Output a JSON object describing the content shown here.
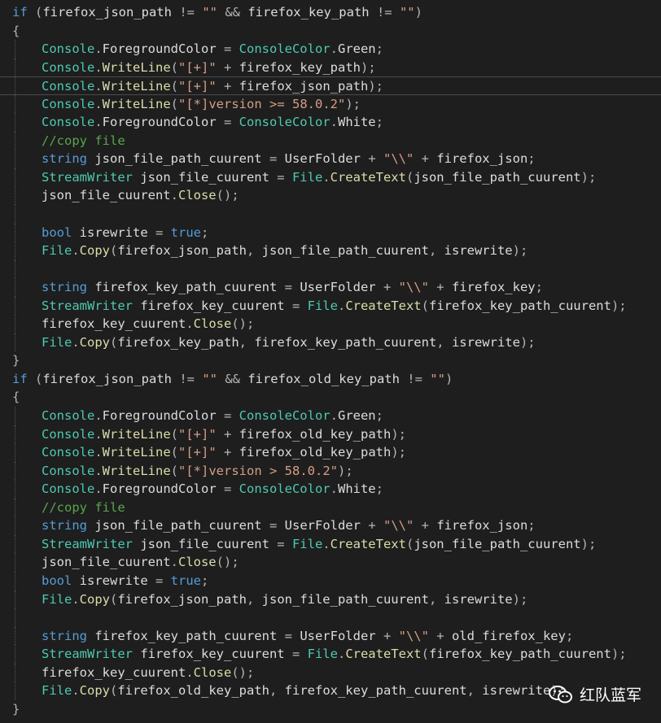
{
  "editor": {
    "lines": [
      {
        "indent": 0,
        "tokens": [
          [
            "kw",
            "if"
          ],
          [
            "pl",
            " ("
          ],
          [
            "id",
            "firefox_json_path"
          ],
          [
            "pl",
            " != "
          ],
          [
            "str",
            "\"\""
          ],
          [
            "pl",
            " && "
          ],
          [
            "id",
            "firefox_key_path"
          ],
          [
            "pl",
            " != "
          ],
          [
            "str",
            "\"\""
          ],
          [
            "pl",
            ")"
          ]
        ]
      },
      {
        "indent": 0,
        "tokens": [
          [
            "pl",
            "{"
          ]
        ]
      },
      {
        "indent": 1,
        "tokens": [
          [
            "type",
            "Console"
          ],
          [
            "pl",
            "."
          ],
          [
            "id",
            "ForegroundColor"
          ],
          [
            "pl",
            " = "
          ],
          [
            "type",
            "ConsoleColor"
          ],
          [
            "pl",
            "."
          ],
          [
            "id",
            "Green"
          ],
          [
            "pl",
            ";"
          ]
        ]
      },
      {
        "indent": 1,
        "tokens": [
          [
            "type",
            "Console"
          ],
          [
            "pl",
            "."
          ],
          [
            "fn",
            "WriteLine"
          ],
          [
            "pl",
            "("
          ],
          [
            "str",
            "\"[+]\""
          ],
          [
            "pl",
            " + "
          ],
          [
            "id",
            "firefox_key_path"
          ],
          [
            "pl",
            ");"
          ]
        ]
      },
      {
        "indent": 1,
        "current": true,
        "tokens": [
          [
            "type",
            "Console"
          ],
          [
            "pl",
            "."
          ],
          [
            "fn",
            "WriteLine"
          ],
          [
            "pl",
            "("
          ],
          [
            "str",
            "\"[+]\""
          ],
          [
            "pl",
            " + "
          ],
          [
            "id",
            "firefox_json_path"
          ],
          [
            "pl",
            ");"
          ]
        ]
      },
      {
        "indent": 1,
        "tokens": [
          [
            "type",
            "Console"
          ],
          [
            "pl",
            "."
          ],
          [
            "fn",
            "WriteLine"
          ],
          [
            "pl",
            "("
          ],
          [
            "str",
            "\"[*]version >= 58.0.2\""
          ],
          [
            "pl",
            ");"
          ]
        ]
      },
      {
        "indent": 1,
        "tokens": [
          [
            "type",
            "Console"
          ],
          [
            "pl",
            "."
          ],
          [
            "id",
            "ForegroundColor"
          ],
          [
            "pl",
            " = "
          ],
          [
            "type",
            "ConsoleColor"
          ],
          [
            "pl",
            "."
          ],
          [
            "id",
            "White"
          ],
          [
            "pl",
            ";"
          ]
        ]
      },
      {
        "indent": 1,
        "tokens": [
          [
            "com",
            "//copy file"
          ]
        ]
      },
      {
        "indent": 1,
        "tokens": [
          [
            "kw",
            "string"
          ],
          [
            "pl",
            " "
          ],
          [
            "id",
            "json_file_path_cuurent"
          ],
          [
            "pl",
            " = "
          ],
          [
            "id",
            "UserFolder"
          ],
          [
            "pl",
            " + "
          ],
          [
            "str",
            "\"\\\\\""
          ],
          [
            "pl",
            " + "
          ],
          [
            "id",
            "firefox_json"
          ],
          [
            "pl",
            ";"
          ]
        ]
      },
      {
        "indent": 1,
        "tokens": [
          [
            "type",
            "StreamWriter"
          ],
          [
            "pl",
            " "
          ],
          [
            "id",
            "json_file_cuurent"
          ],
          [
            "pl",
            " = "
          ],
          [
            "type",
            "File"
          ],
          [
            "pl",
            "."
          ],
          [
            "fn",
            "CreateText"
          ],
          [
            "pl",
            "("
          ],
          [
            "id",
            "json_file_path_cuurent"
          ],
          [
            "pl",
            ");"
          ]
        ]
      },
      {
        "indent": 1,
        "tokens": [
          [
            "id",
            "json_file_cuurent"
          ],
          [
            "pl",
            "."
          ],
          [
            "fn",
            "Close"
          ],
          [
            "pl",
            "();"
          ]
        ]
      },
      {
        "indent": 1,
        "tokens": []
      },
      {
        "indent": 1,
        "tokens": [
          [
            "kw",
            "bool"
          ],
          [
            "pl",
            " "
          ],
          [
            "id",
            "isrewrite"
          ],
          [
            "pl",
            " = "
          ],
          [
            "kw",
            "true"
          ],
          [
            "pl",
            ";"
          ]
        ]
      },
      {
        "indent": 1,
        "tokens": [
          [
            "type",
            "File"
          ],
          [
            "pl",
            "."
          ],
          [
            "fn",
            "Copy"
          ],
          [
            "pl",
            "("
          ],
          [
            "id",
            "firefox_json_path"
          ],
          [
            "pl",
            ", "
          ],
          [
            "id",
            "json_file_path_cuurent"
          ],
          [
            "pl",
            ", "
          ],
          [
            "id",
            "isrewrite"
          ],
          [
            "pl",
            ");"
          ]
        ]
      },
      {
        "indent": 1,
        "tokens": []
      },
      {
        "indent": 1,
        "tokens": [
          [
            "kw",
            "string"
          ],
          [
            "pl",
            " "
          ],
          [
            "id",
            "firefox_key_path_cuurent"
          ],
          [
            "pl",
            " = "
          ],
          [
            "id",
            "UserFolder"
          ],
          [
            "pl",
            " + "
          ],
          [
            "str",
            "\"\\\\\""
          ],
          [
            "pl",
            " + "
          ],
          [
            "id",
            "firefox_key"
          ],
          [
            "pl",
            ";"
          ]
        ]
      },
      {
        "indent": 1,
        "tokens": [
          [
            "type",
            "StreamWriter"
          ],
          [
            "pl",
            " "
          ],
          [
            "id",
            "firefox_key_cuurent"
          ],
          [
            "pl",
            " = "
          ],
          [
            "type",
            "File"
          ],
          [
            "pl",
            "."
          ],
          [
            "fn",
            "CreateText"
          ],
          [
            "pl",
            "("
          ],
          [
            "id",
            "firefox_key_path_cuurent"
          ],
          [
            "pl",
            ");"
          ]
        ]
      },
      {
        "indent": 1,
        "tokens": [
          [
            "id",
            "firefox_key_cuurent"
          ],
          [
            "pl",
            "."
          ],
          [
            "fn",
            "Close"
          ],
          [
            "pl",
            "();"
          ]
        ]
      },
      {
        "indent": 1,
        "tokens": [
          [
            "type",
            "File"
          ],
          [
            "pl",
            "."
          ],
          [
            "fn",
            "Copy"
          ],
          [
            "pl",
            "("
          ],
          [
            "id",
            "firefox_key_path"
          ],
          [
            "pl",
            ", "
          ],
          [
            "id",
            "firefox_key_path_cuurent"
          ],
          [
            "pl",
            ", "
          ],
          [
            "id",
            "isrewrite"
          ],
          [
            "pl",
            ");"
          ]
        ]
      },
      {
        "indent": 0,
        "tokens": [
          [
            "pl",
            "}"
          ]
        ]
      },
      {
        "indent": 0,
        "tokens": [
          [
            "kw",
            "if"
          ],
          [
            "pl",
            " ("
          ],
          [
            "id",
            "firefox_json_path"
          ],
          [
            "pl",
            " != "
          ],
          [
            "str",
            "\"\""
          ],
          [
            "pl",
            " && "
          ],
          [
            "id",
            "firefox_old_key_path"
          ],
          [
            "pl",
            " != "
          ],
          [
            "str",
            "\"\""
          ],
          [
            "pl",
            ")"
          ]
        ]
      },
      {
        "indent": 0,
        "tokens": [
          [
            "pl",
            "{"
          ]
        ]
      },
      {
        "indent": 1,
        "tokens": [
          [
            "type",
            "Console"
          ],
          [
            "pl",
            "."
          ],
          [
            "id",
            "ForegroundColor"
          ],
          [
            "pl",
            " = "
          ],
          [
            "type",
            "ConsoleColor"
          ],
          [
            "pl",
            "."
          ],
          [
            "id",
            "Green"
          ],
          [
            "pl",
            ";"
          ]
        ]
      },
      {
        "indent": 1,
        "tokens": [
          [
            "type",
            "Console"
          ],
          [
            "pl",
            "."
          ],
          [
            "fn",
            "WriteLine"
          ],
          [
            "pl",
            "("
          ],
          [
            "str",
            "\"[+]\""
          ],
          [
            "pl",
            " + "
          ],
          [
            "id",
            "firefox_old_key_path"
          ],
          [
            "pl",
            ");"
          ]
        ]
      },
      {
        "indent": 1,
        "tokens": [
          [
            "type",
            "Console"
          ],
          [
            "pl",
            "."
          ],
          [
            "fn",
            "WriteLine"
          ],
          [
            "pl",
            "("
          ],
          [
            "str",
            "\"[+]\""
          ],
          [
            "pl",
            " + "
          ],
          [
            "id",
            "firefox_old_key_path"
          ],
          [
            "pl",
            ");"
          ]
        ]
      },
      {
        "indent": 1,
        "tokens": [
          [
            "type",
            "Console"
          ],
          [
            "pl",
            "."
          ],
          [
            "fn",
            "WriteLine"
          ],
          [
            "pl",
            "("
          ],
          [
            "str",
            "\"[*]version > 58.0.2\""
          ],
          [
            "pl",
            ");"
          ]
        ]
      },
      {
        "indent": 1,
        "tokens": [
          [
            "type",
            "Console"
          ],
          [
            "pl",
            "."
          ],
          [
            "id",
            "ForegroundColor"
          ],
          [
            "pl",
            " = "
          ],
          [
            "type",
            "ConsoleColor"
          ],
          [
            "pl",
            "."
          ],
          [
            "id",
            "White"
          ],
          [
            "pl",
            ";"
          ]
        ]
      },
      {
        "indent": 1,
        "tokens": [
          [
            "com",
            "//copy file"
          ]
        ]
      },
      {
        "indent": 1,
        "tokens": [
          [
            "kw",
            "string"
          ],
          [
            "pl",
            " "
          ],
          [
            "id",
            "json_file_path_cuurent"
          ],
          [
            "pl",
            " = "
          ],
          [
            "id",
            "UserFolder"
          ],
          [
            "pl",
            " + "
          ],
          [
            "str",
            "\"\\\\\""
          ],
          [
            "pl",
            " + "
          ],
          [
            "id",
            "firefox_json"
          ],
          [
            "pl",
            ";"
          ]
        ]
      },
      {
        "indent": 1,
        "tokens": [
          [
            "type",
            "StreamWriter"
          ],
          [
            "pl",
            " "
          ],
          [
            "id",
            "json_file_cuurent"
          ],
          [
            "pl",
            " = "
          ],
          [
            "type",
            "File"
          ],
          [
            "pl",
            "."
          ],
          [
            "fn",
            "CreateText"
          ],
          [
            "pl",
            "("
          ],
          [
            "id",
            "json_file_path_cuurent"
          ],
          [
            "pl",
            ");"
          ]
        ]
      },
      {
        "indent": 1,
        "tokens": [
          [
            "id",
            "json_file_cuurent"
          ],
          [
            "pl",
            "."
          ],
          [
            "fn",
            "Close"
          ],
          [
            "pl",
            "();"
          ]
        ]
      },
      {
        "indent": 1,
        "tokens": [
          [
            "kw",
            "bool"
          ],
          [
            "pl",
            " "
          ],
          [
            "id",
            "isrewrite"
          ],
          [
            "pl",
            " = "
          ],
          [
            "kw",
            "true"
          ],
          [
            "pl",
            ";"
          ]
        ]
      },
      {
        "indent": 1,
        "tokens": [
          [
            "type",
            "File"
          ],
          [
            "pl",
            "."
          ],
          [
            "fn",
            "Copy"
          ],
          [
            "pl",
            "("
          ],
          [
            "id",
            "firefox_json_path"
          ],
          [
            "pl",
            ", "
          ],
          [
            "id",
            "json_file_path_cuurent"
          ],
          [
            "pl",
            ", "
          ],
          [
            "id",
            "isrewrite"
          ],
          [
            "pl",
            ");"
          ]
        ]
      },
      {
        "indent": 1,
        "tokens": []
      },
      {
        "indent": 1,
        "tokens": [
          [
            "kw",
            "string"
          ],
          [
            "pl",
            " "
          ],
          [
            "id",
            "firefox_key_path_cuurent"
          ],
          [
            "pl",
            " = "
          ],
          [
            "id",
            "UserFolder"
          ],
          [
            "pl",
            " + "
          ],
          [
            "str",
            "\"\\\\\""
          ],
          [
            "pl",
            " + "
          ],
          [
            "id",
            "old_firefox_key"
          ],
          [
            "pl",
            ";"
          ]
        ]
      },
      {
        "indent": 1,
        "tokens": [
          [
            "type",
            "StreamWriter"
          ],
          [
            "pl",
            " "
          ],
          [
            "id",
            "firefox_key_cuurent"
          ],
          [
            "pl",
            " = "
          ],
          [
            "type",
            "File"
          ],
          [
            "pl",
            "."
          ],
          [
            "fn",
            "CreateText"
          ],
          [
            "pl",
            "("
          ],
          [
            "id",
            "firefox_key_path_cuurent"
          ],
          [
            "pl",
            ");"
          ]
        ]
      },
      {
        "indent": 1,
        "tokens": [
          [
            "id",
            "firefox_key_cuurent"
          ],
          [
            "pl",
            "."
          ],
          [
            "fn",
            "Close"
          ],
          [
            "pl",
            "();"
          ]
        ]
      },
      {
        "indent": 1,
        "tokens": [
          [
            "type",
            "File"
          ],
          [
            "pl",
            "."
          ],
          [
            "fn",
            "Copy"
          ],
          [
            "pl",
            "("
          ],
          [
            "id",
            "firefox_old_key_path"
          ],
          [
            "pl",
            ", "
          ],
          [
            "id",
            "firefox_key_path_cuurent"
          ],
          [
            "pl",
            ", "
          ],
          [
            "id",
            "isrewrite"
          ],
          [
            "pl",
            ");"
          ]
        ]
      },
      {
        "indent": 0,
        "tokens": [
          [
            "pl",
            "}"
          ]
        ]
      }
    ],
    "colors": {
      "background": "#1e1e1e",
      "keyword": "#569cd6",
      "type": "#4ec9b0",
      "string": "#d69d85",
      "comment": "#57a64a",
      "identifier": "#dcdcdc",
      "method": "#dcdcaa"
    }
  },
  "watermark": {
    "icon": "wechat-icon",
    "label": "红队蓝军"
  }
}
